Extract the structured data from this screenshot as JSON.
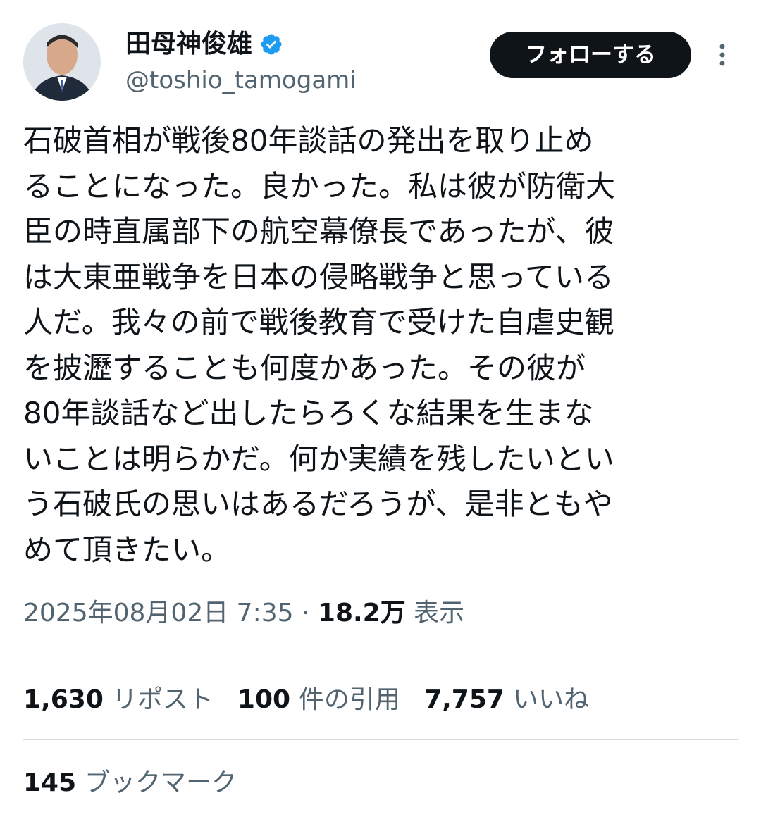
{
  "author": {
    "display_name": "田母神俊雄",
    "handle": "@toshio_tamogami",
    "verified": true,
    "verified_color": "#1d9bf0"
  },
  "actions": {
    "follow_label": "フォローする",
    "more_icon": "more-vertical-icon"
  },
  "tweet": {
    "lines": [
      "石破首相が戦後80年談話の発出を取り止め",
      "ることになった。良かった。私は彼が防衛大",
      "臣の時直属部下の航空幕僚長であったが、彼",
      "は大東亜戦争を日本の侵略戦争と思っている",
      "人だ。我々の前で戦後教育で受けた自虐史観",
      "を披瀝することも何度かあった。その彼が",
      "80年談話など出したらろくな結果を生まな",
      "いことは明らかだ。何か実績を残したいとい",
      "う石破氏の思いはあるだろうが、是非ともや",
      "めて頂きたい。"
    ]
  },
  "meta": {
    "timestamp": "2025年08月02日 7:35",
    "separator": "·",
    "views_count": "18.2万",
    "views_label": "表示"
  },
  "stats": {
    "reposts_count": "1,630",
    "reposts_label": "リポスト",
    "quotes_count": "100",
    "quotes_label": "件の引用",
    "likes_count": "7,757",
    "likes_label": "いいね",
    "bookmarks_count": "145",
    "bookmarks_label": "ブックマーク"
  },
  "colors": {
    "text_primary": "#0f1419",
    "text_secondary": "#536471",
    "divider": "#cfd9de",
    "button_bg": "#0f1419"
  }
}
